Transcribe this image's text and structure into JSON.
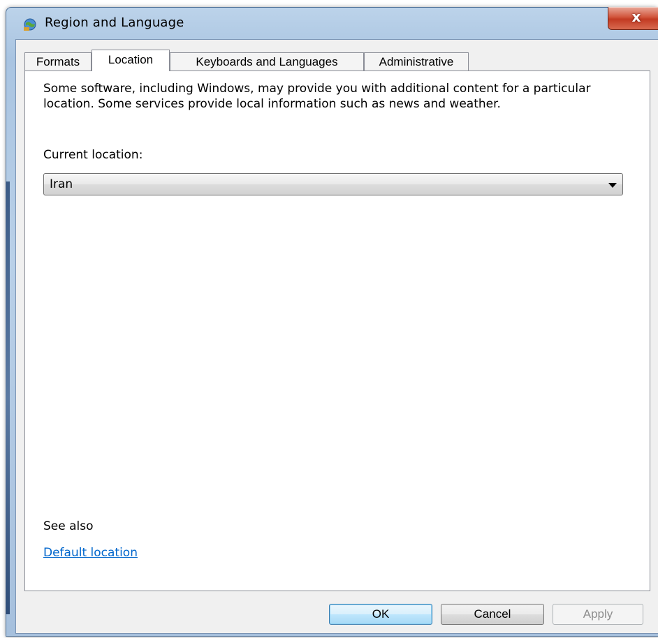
{
  "window": {
    "title": "Region and Language",
    "close_glyph": "x",
    "icon": "globe-icon"
  },
  "tabs": [
    {
      "label": "Formats",
      "active": false
    },
    {
      "label": "Location",
      "active": true
    },
    {
      "label": "Keyboards and Languages",
      "active": false
    },
    {
      "label": "Administrative",
      "active": false
    }
  ],
  "location": {
    "description": "Some software, including Windows, may provide you with additional content for a particular location. Some services provide local information such as news and weather.",
    "current_label": "Current location:",
    "current_value": "Iran",
    "see_also": "See also",
    "default_link": "Default location"
  },
  "buttons": {
    "ok": "OK",
    "cancel": "Cancel",
    "apply": "Apply",
    "apply_enabled": false
  }
}
